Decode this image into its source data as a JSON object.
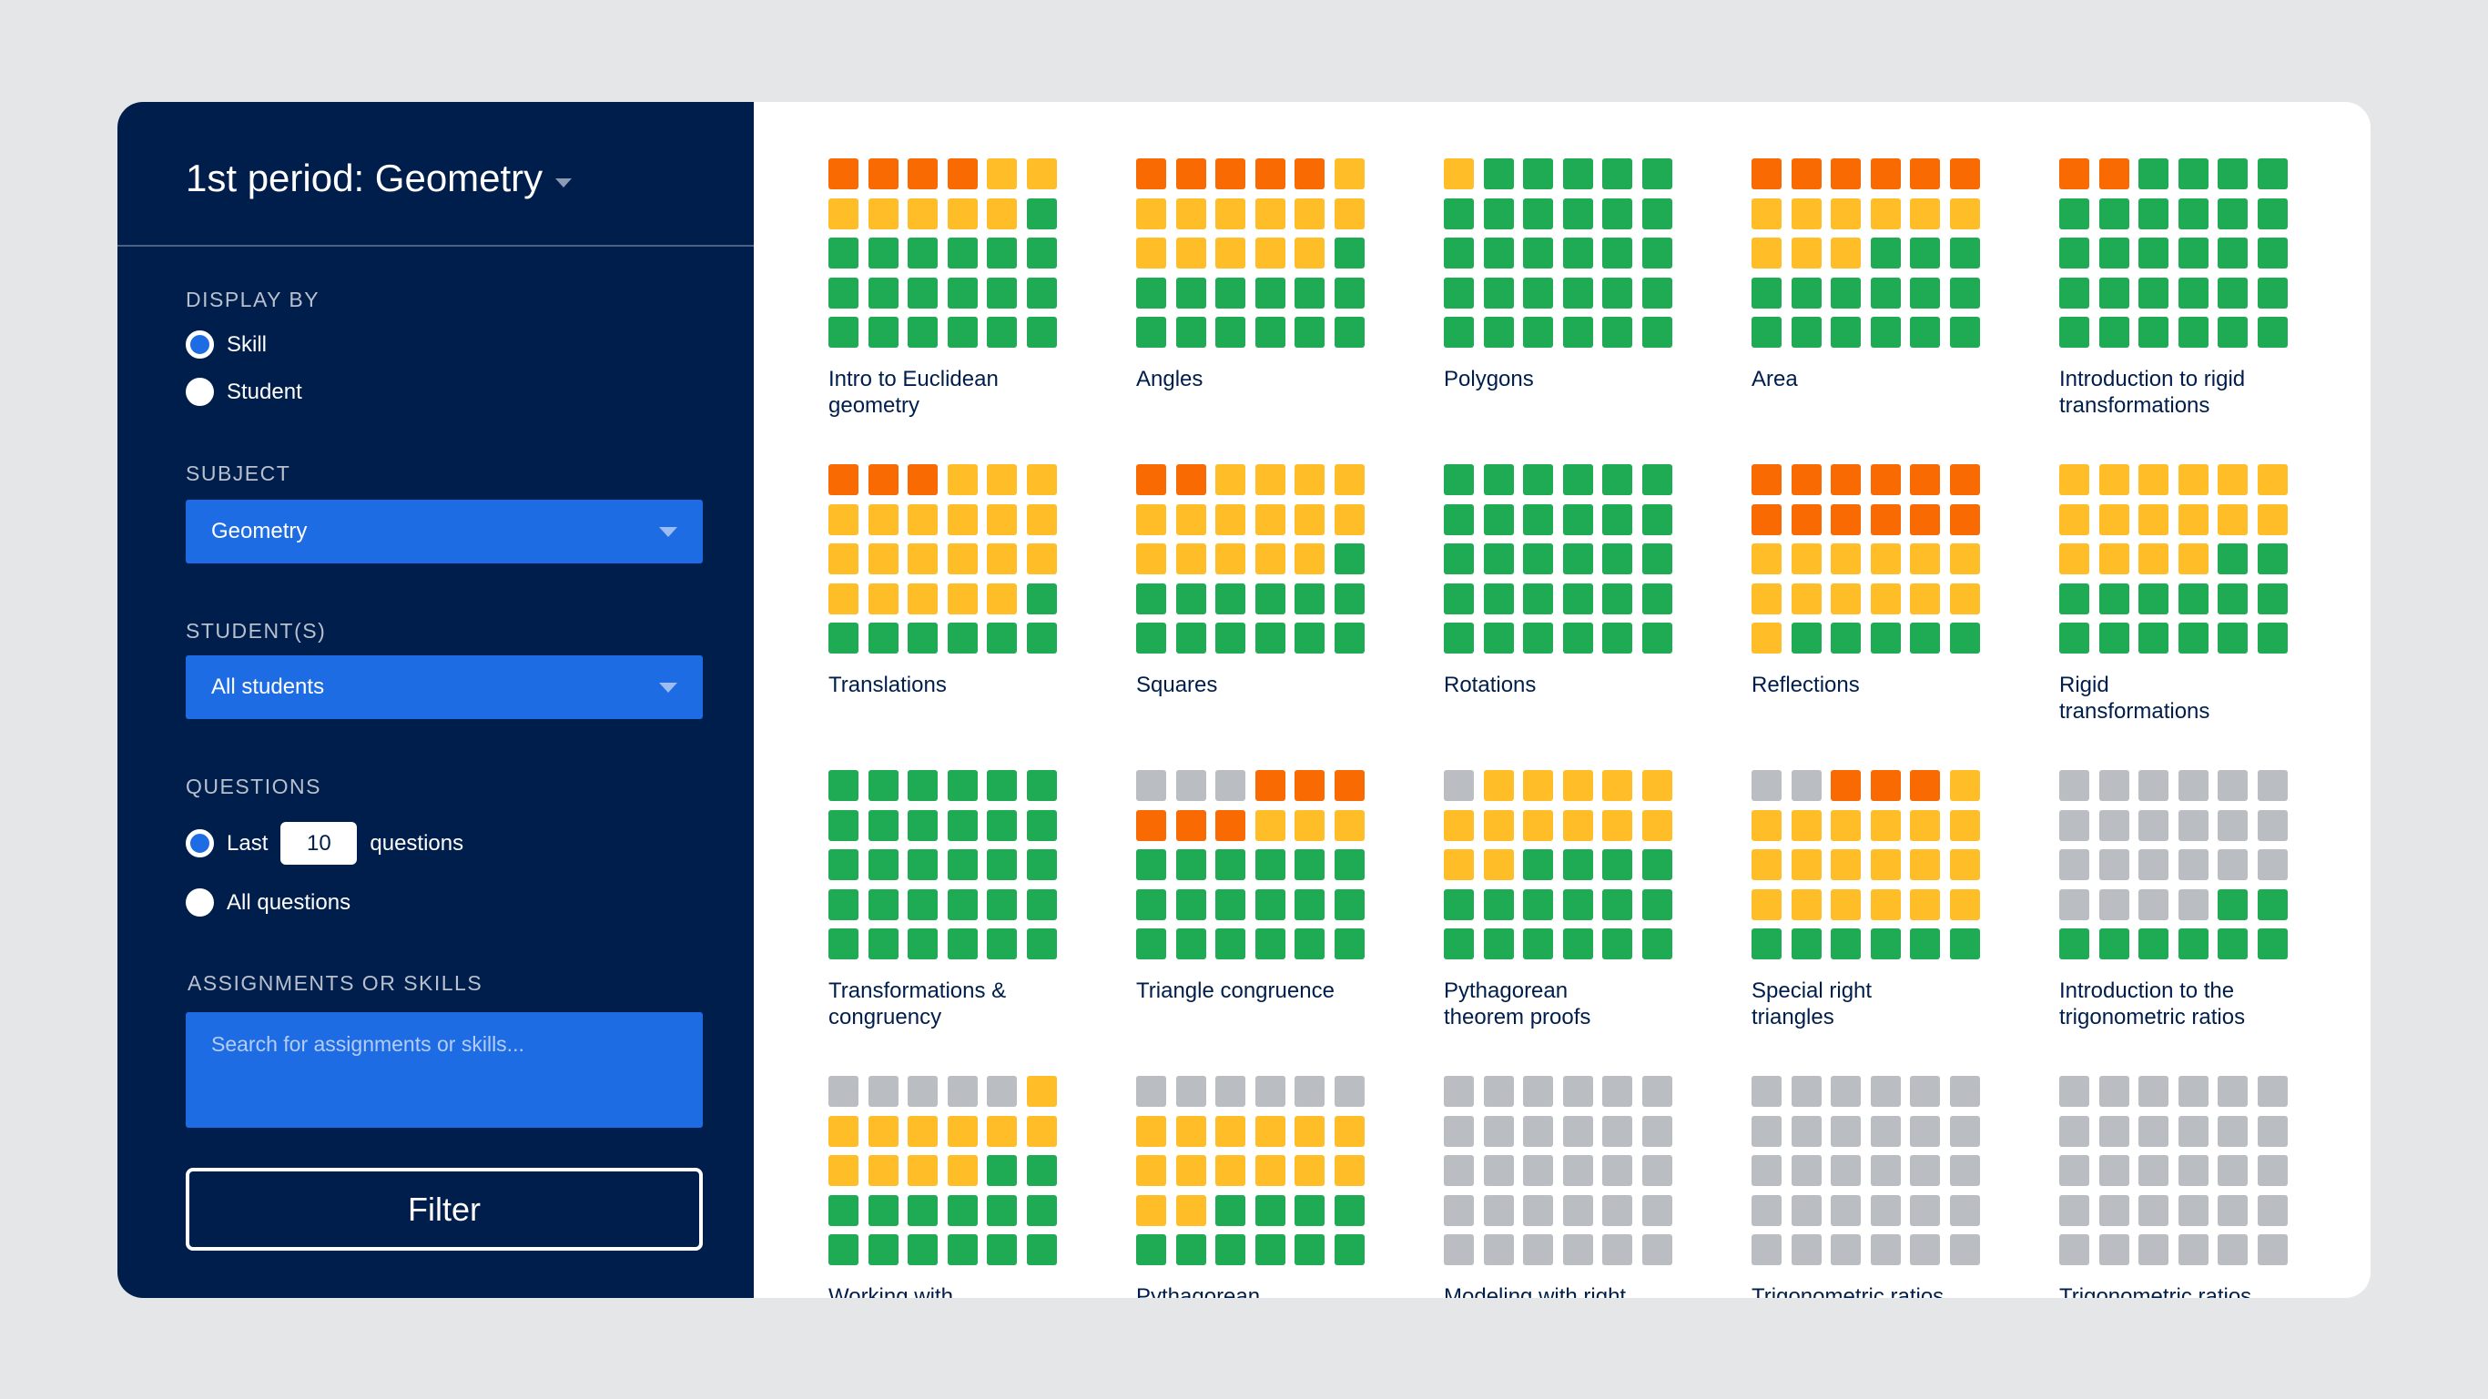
{
  "colors": {
    "O": "#F96A02",
    "Y": "#FFBE28",
    "G": "#1FAB54",
    "N": "#BABDC2",
    "navy": "#001E4C",
    "blue": "#1E6CE3"
  },
  "sidebar": {
    "title": "1st period: Geometry",
    "display_by": {
      "label": "DISPLAY BY",
      "options": [
        "Skill",
        "Student"
      ],
      "selected": "Skill"
    },
    "subject": {
      "label": "SUBJECT",
      "value": "Geometry"
    },
    "students": {
      "label": "STUDENT(S)",
      "value": "All students"
    },
    "questions": {
      "label": "QUESTIONS",
      "last_prefix": "Last",
      "count": "10",
      "last_suffix": "questions",
      "all_label": "All questions",
      "selected": "last"
    },
    "assignments": {
      "label": "ASSIGNMENTS OR SKILLS",
      "placeholder": "Search for assignments or skills..."
    },
    "filter_label": "Filter"
  },
  "skills": [
    {
      "label": "Intro to Euclidean\ngeometry",
      "rows": [
        "OOOOYY",
        "YYYYYG",
        "GGGGGG",
        "GGGGGG",
        "GGGGGG"
      ]
    },
    {
      "label": "Angles",
      "rows": [
        "OOOOOY",
        "YYYYYY",
        "YYYYYG",
        "GGGGGG",
        "GGGGGG"
      ]
    },
    {
      "label": "Polygons",
      "rows": [
        "YGGGGG",
        "GGGGGG",
        "GGGGGG",
        "GGGGGG",
        "GGGGGG"
      ]
    },
    {
      "label": "Area",
      "rows": [
        "OOOOOO",
        "YYYYYY",
        "YYYGGG",
        "GGGGGG",
        "GGGGGG"
      ]
    },
    {
      "label": "Introduction to rigid\ntransformations",
      "rows": [
        "OOGGGG",
        "GGGGGG",
        "GGGGGG",
        "GGGGGG",
        "GGGGGG"
      ]
    },
    {
      "label": "Translations",
      "rows": [
        "OOOYYY",
        "YYYYYY",
        "YYYYYY",
        "YYYYYG",
        "GGGGGG"
      ]
    },
    {
      "label": "Squares",
      "rows": [
        "OOYYYY",
        "YYYYYY",
        "YYYYYG",
        "GGGGGG",
        "GGGGGG"
      ]
    },
    {
      "label": "Rotations",
      "rows": [
        "GGGGGG",
        "GGGGGG",
        "GGGGGG",
        "GGGGGG",
        "GGGGGG"
      ]
    },
    {
      "label": "Reflections",
      "rows": [
        "OOOOOO",
        "OOOOOO",
        "YYYYYY",
        "YYYYYY",
        "YGGGGG"
      ]
    },
    {
      "label": "Rigid\ntransformations",
      "rows": [
        "YYYYYY",
        "YYYYYY",
        "YYYYGG",
        "GGGGGG",
        "GGGGGG"
      ]
    },
    {
      "label": "Transformations &\ncongruency",
      "rows": [
        "GGGGGG",
        "GGGGGG",
        "GGGGGG",
        "GGGGGG",
        "GGGGGG"
      ]
    },
    {
      "label": "Triangle congruence",
      "rows": [
        "NNNOOO",
        "OOOYYY",
        "GGGGGG",
        "GGGGGG",
        "GGGGGG"
      ]
    },
    {
      "label": "Pythagorean\ntheorem proofs",
      "rows": [
        "NYYYYY",
        "YYYYYY",
        "YYGGGG",
        "GGGGGG",
        "GGGGGG"
      ]
    },
    {
      "label": "Special right\ntriangles",
      "rows": [
        "NNOOOY",
        "YYYYYY",
        "YYYYYY",
        "YYYYYY",
        "GGGGGG"
      ]
    },
    {
      "label": "Introduction to the\ntrigonometric ratios",
      "rows": [
        "NNNNNN",
        "NNNNNN",
        "NNNNNN",
        "NNNNGG",
        "GGGGGG"
      ]
    },
    {
      "label": "Working with",
      "rows": [
        "NNNNNY",
        "YYYYYY",
        "YYYYGG",
        "GGGGGG",
        "GGGGGG"
      ]
    },
    {
      "label": "Pythagorean",
      "rows": [
        "NNNNNN",
        "YYYYYY",
        "YYYYYY",
        "YYGGGG",
        "GGGGGG"
      ]
    },
    {
      "label": "Modeling with right",
      "rows": [
        "NNNNNN",
        "NNNNNN",
        "NNNNNN",
        "NNNNNN",
        "NNNNNN"
      ]
    },
    {
      "label": "Trigonometric ratios",
      "rows": [
        "NNNNNN",
        "NNNNNN",
        "NNNNNN",
        "NNNNNN",
        "NNNNNN"
      ]
    },
    {
      "label": "Trigonometric ratios",
      "rows": [
        "NNNNNN",
        "NNNNNN",
        "NNNNNN",
        "NNNNNN",
        "NNNNNN"
      ]
    }
  ]
}
